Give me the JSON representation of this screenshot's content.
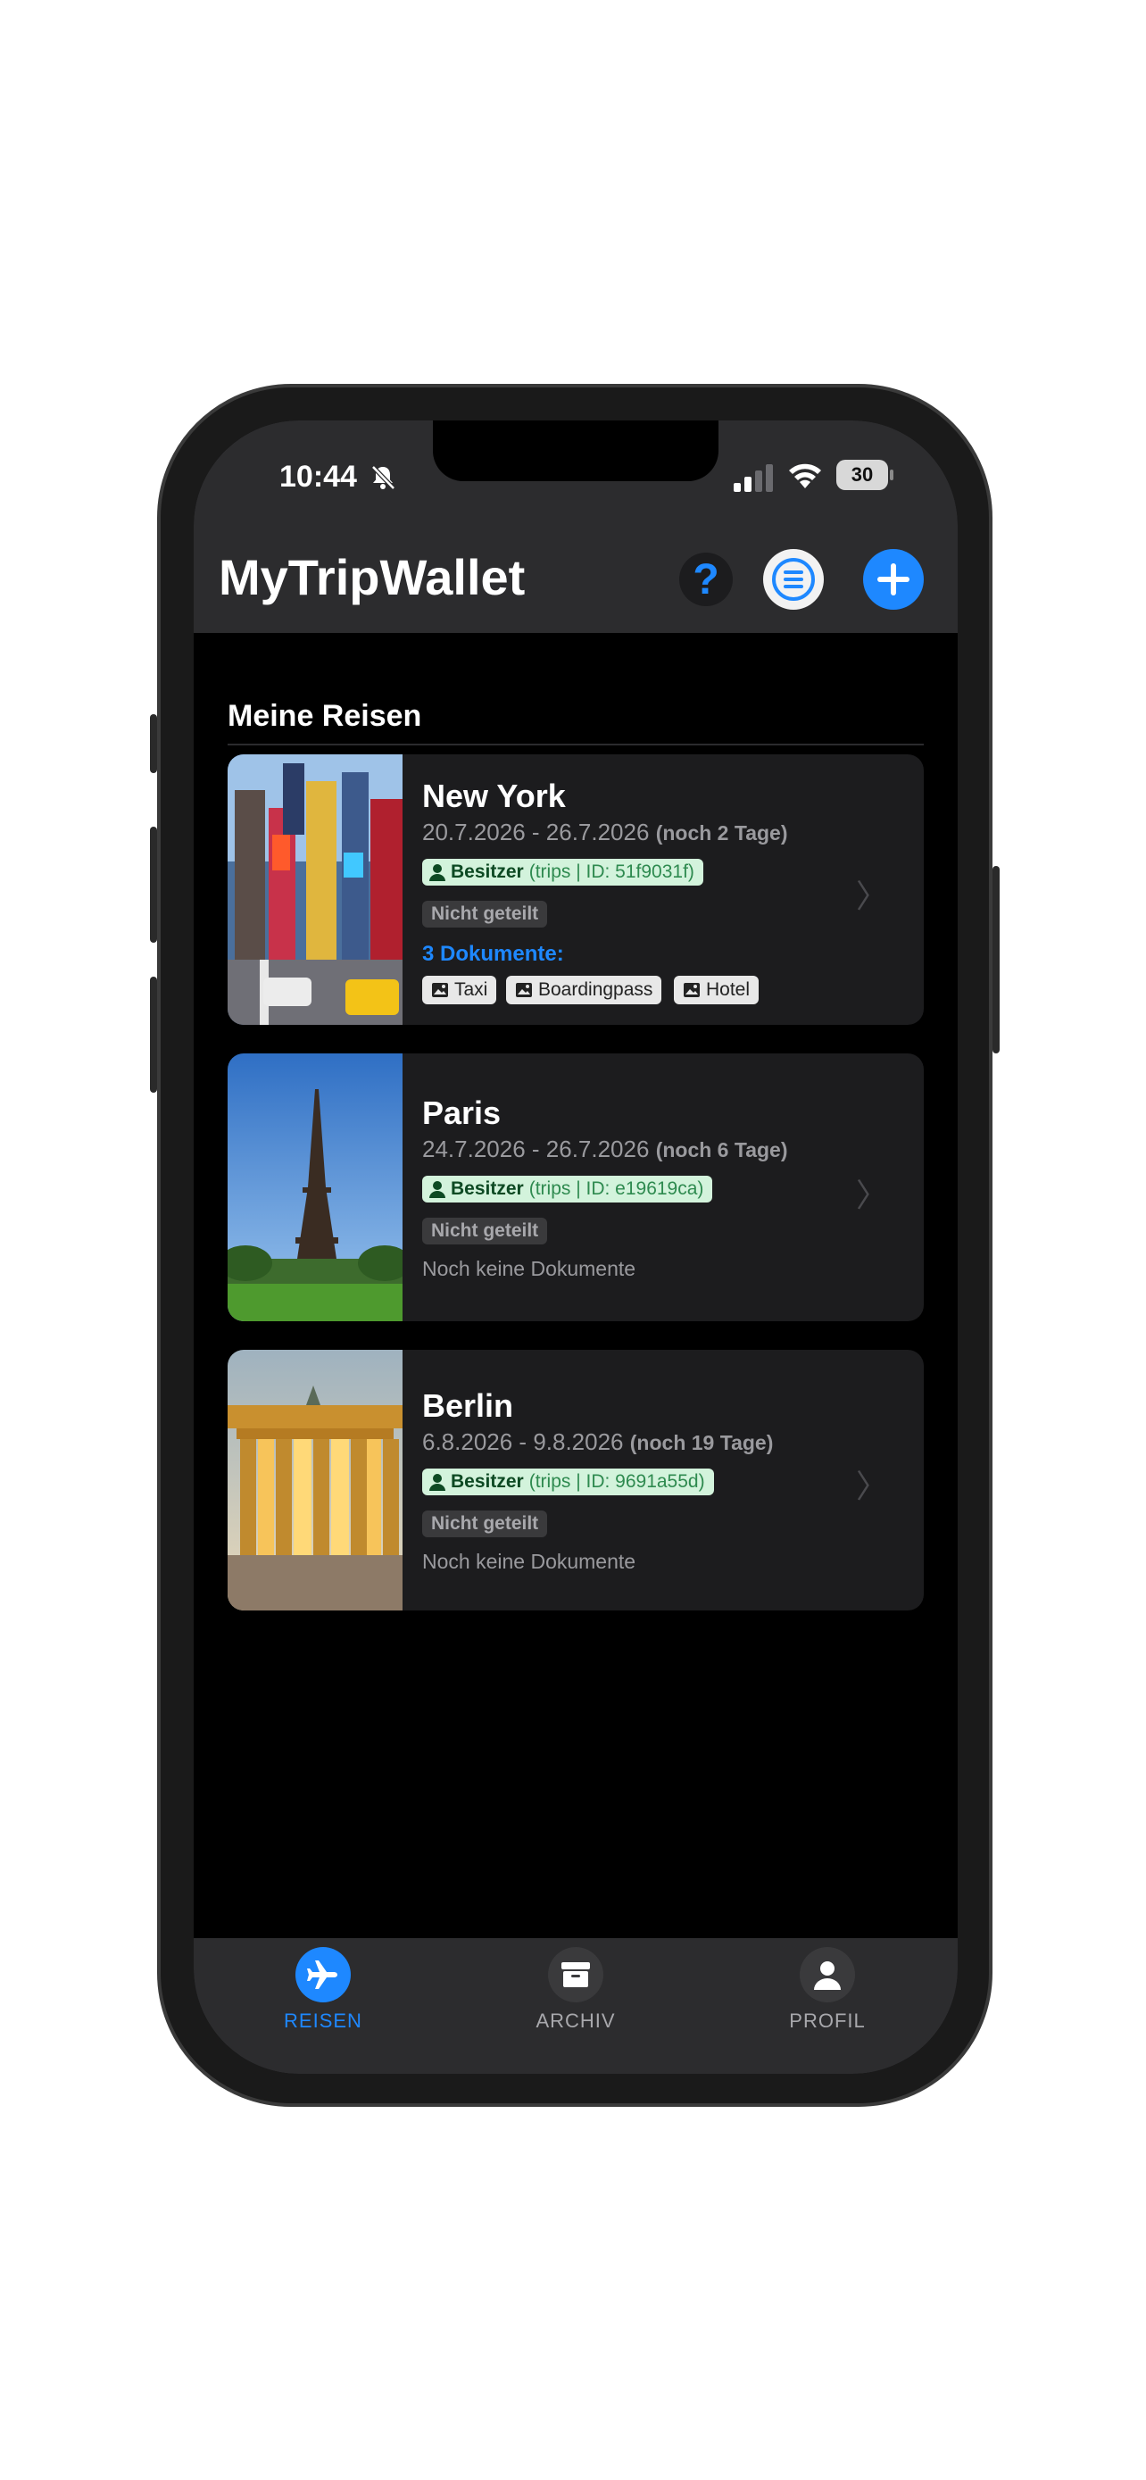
{
  "status_bar": {
    "time": "10:44",
    "battery": "30"
  },
  "header": {
    "title": "MyTripWallet",
    "help_label": "?"
  },
  "section": {
    "title": "Meine Reisen"
  },
  "trips": [
    {
      "city": "New York",
      "dates": "20.7.2026 - 26.7.2026",
      "countdown": "(noch 2 Tage)",
      "owner_label": "Besitzer",
      "trip_ref": "(trips | ID: 51f9031f)",
      "share_status": "Nicht geteilt",
      "documents_title": "3 Dokumente:",
      "documents": [
        "Taxi",
        "Boardingpass",
        "Hotel"
      ],
      "no_documents": ""
    },
    {
      "city": "Paris",
      "dates": "24.7.2026 - 26.7.2026",
      "countdown": "(noch 6 Tage)",
      "owner_label": "Besitzer",
      "trip_ref": "(trips | ID: e19619ca)",
      "share_status": "Nicht geteilt",
      "documents_title": "",
      "documents": [],
      "no_documents": "Noch keine Dokumente"
    },
    {
      "city": "Berlin",
      "dates": "6.8.2026 - 9.8.2026",
      "countdown": "(noch 19 Tage)",
      "owner_label": "Besitzer",
      "trip_ref": "(trips | ID: 9691a55d)",
      "share_status": "Nicht geteilt",
      "documents_title": "",
      "documents": [],
      "no_documents": "Noch keine Dokumente"
    }
  ],
  "tabbar": {
    "tabs": [
      {
        "label": "REISEN",
        "icon": "airplane-icon",
        "active": true
      },
      {
        "label": "ARCHIV",
        "icon": "archive-box-icon",
        "active": false
      },
      {
        "label": "PROFIL",
        "icon": "person-icon",
        "active": false
      }
    ]
  },
  "colors": {
    "accent": "#1e88ff",
    "header_bg": "#2c2c2e",
    "card_bg": "#1c1c1e",
    "owner_badge_bg": "#d3f3dc"
  }
}
